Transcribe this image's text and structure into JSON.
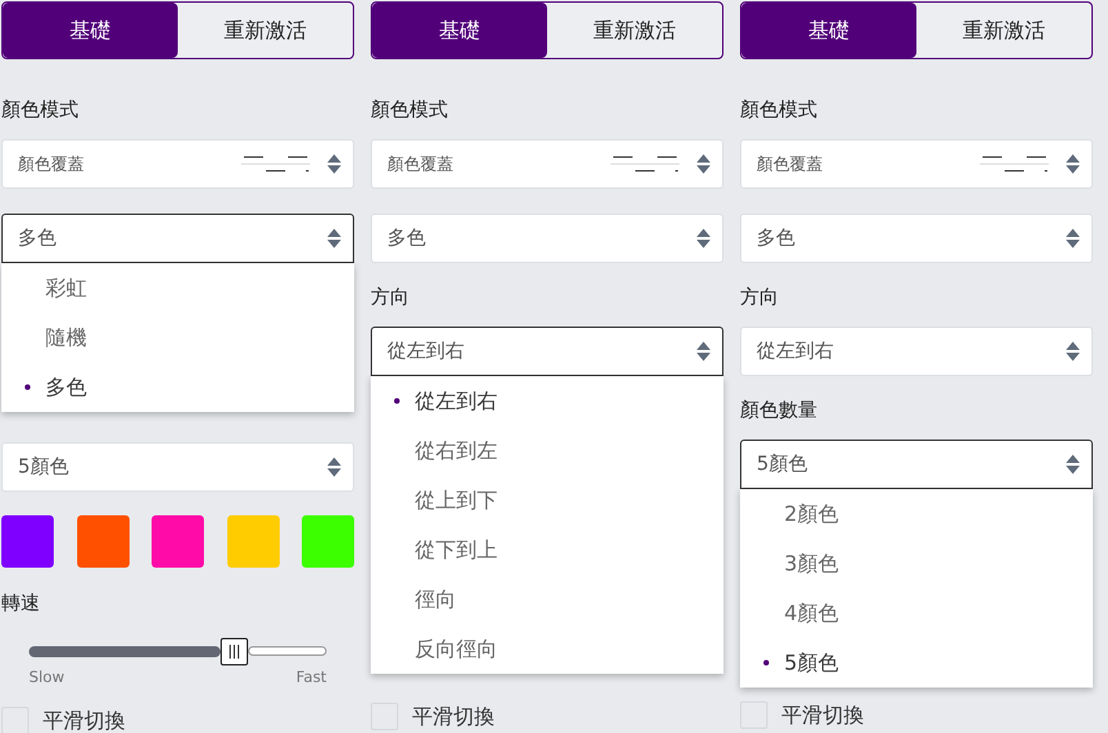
{
  "panels": [
    {
      "tabs": [
        {
          "label": "基礎",
          "selected": true
        },
        {
          "label": "重新激活",
          "selected": false
        }
      ],
      "items": [
        {
          "kind": "label",
          "text": "顏色模式"
        },
        {
          "kind": "pattern-select",
          "value": "顏色覆蓋",
          "expanded": false
        },
        {
          "kind": "select",
          "value": "多色",
          "expanded": true
        },
        {
          "kind": "menu",
          "options": [
            {
              "label": "彩虹",
              "selected": false
            },
            {
              "label": "隨機",
              "selected": false
            },
            {
              "label": "多色",
              "selected": true
            }
          ]
        },
        {
          "kind": "select",
          "value": "5顏色",
          "expanded": false
        },
        {
          "kind": "swatches",
          "colors": [
            {
              "color": "#7f00ff"
            },
            {
              "color": "#ff5000"
            },
            {
              "color": "#ff0ca8"
            },
            {
              "color": "#ffcc00"
            },
            {
              "color": "#3cff00"
            }
          ]
        },
        {
          "kind": "label",
          "text": "轉速"
        },
        {
          "kind": "slider",
          "level": 0.69
        },
        {
          "kind": "slider-labels",
          "min_label": "Slow",
          "max_label": "Fast"
        },
        {
          "kind": "checkbox",
          "label": "平滑切換",
          "checked": false
        }
      ]
    },
    {
      "tabs": [
        {
          "label": "基礎",
          "selected": true
        },
        {
          "label": "重新激活",
          "selected": false
        }
      ],
      "items": [
        {
          "kind": "label",
          "text": "顏色模式"
        },
        {
          "kind": "pattern-select",
          "value": "顏色覆蓋",
          "expanded": false
        },
        {
          "kind": "select",
          "value": "多色",
          "expanded": false
        },
        {
          "kind": "label",
          "text": "方向"
        },
        {
          "kind": "select",
          "value": "從左到右",
          "expanded": true
        },
        {
          "kind": "menu",
          "options": [
            {
              "label": "從左到右",
              "selected": true
            },
            {
              "label": "從右到左",
              "selected": false
            },
            {
              "label": "從上到下",
              "selected": false
            },
            {
              "label": "從下到上",
              "selected": false
            },
            {
              "label": "徑向",
              "selected": false
            },
            {
              "label": "反向徑向",
              "selected": false
            }
          ]
        },
        {
          "kind": "checkbox",
          "label": "平滑切換",
          "checked": false
        }
      ]
    },
    {
      "tabs": [
        {
          "label": "基礎",
          "selected": true
        },
        {
          "label": "重新激活",
          "selected": false
        }
      ],
      "items": [
        {
          "kind": "label",
          "text": "顏色模式"
        },
        {
          "kind": "pattern-select",
          "value": "顏色覆蓋",
          "expanded": false
        },
        {
          "kind": "select",
          "value": "多色",
          "expanded": false
        },
        {
          "kind": "label",
          "text": "方向"
        },
        {
          "kind": "select",
          "value": "從左到右",
          "expanded": false
        },
        {
          "kind": "label",
          "text": "顏色數量"
        },
        {
          "kind": "select",
          "value": "5顏色",
          "expanded": true
        },
        {
          "kind": "menu",
          "options": [
            {
              "label": "2顏色",
              "selected": false
            },
            {
              "label": "3顏色",
              "selected": false
            },
            {
              "label": "4顏色",
              "selected": false
            },
            {
              "label": "5顏色",
              "selected": true
            }
          ]
        },
        {
          "kind": "checkbox",
          "label": "平滑切換",
          "checked": false
        }
      ]
    }
  ]
}
